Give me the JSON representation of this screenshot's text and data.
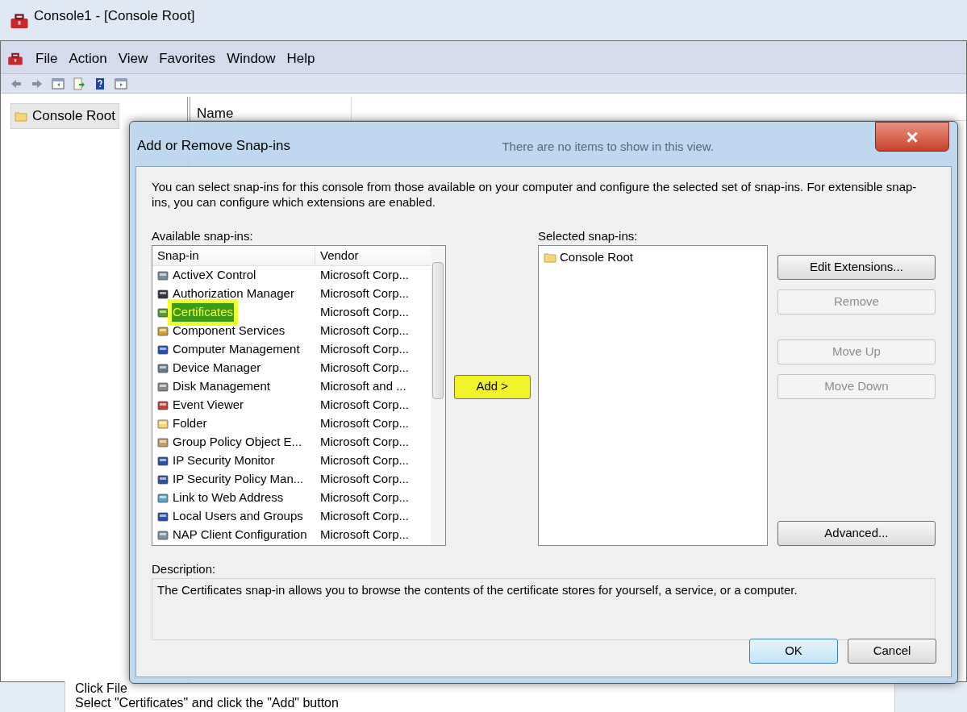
{
  "console": {
    "title": "Console1 - [Console Root]",
    "menu": [
      "File",
      "Action",
      "View",
      "Favorites",
      "Window",
      "Help"
    ],
    "tree": [
      {
        "label": "Console Root",
        "selected": true
      }
    ],
    "columns": [
      "Name"
    ],
    "empty_message": "There are no items to show in this view."
  },
  "dialog": {
    "title": "Add or Remove Snap-ins",
    "close": "×",
    "intro": "You can select snap-ins for this console from those available on your computer and configure the selected set of snap-ins. For extensible snap-ins, you can configure which extensions are enabled.",
    "available_label": "Available snap-ins:",
    "available_columns": [
      "Snap-in",
      "Vendor"
    ],
    "available": [
      {
        "name": "ActiveX Control",
        "vendor": "Microsoft Corp...",
        "selected": false
      },
      {
        "name": "Authorization Manager",
        "vendor": "Microsoft Corp...",
        "selected": false
      },
      {
        "name": "Certificates",
        "vendor": "Microsoft Corp...",
        "selected": true
      },
      {
        "name": "Component Services",
        "vendor": "Microsoft Corp...",
        "selected": false
      },
      {
        "name": "Computer Management",
        "vendor": "Microsoft Corp...",
        "selected": false
      },
      {
        "name": "Device Manager",
        "vendor": "Microsoft Corp...",
        "selected": false
      },
      {
        "name": "Disk Management",
        "vendor": "Microsoft and ...",
        "selected": false
      },
      {
        "name": "Event Viewer",
        "vendor": "Microsoft Corp...",
        "selected": false
      },
      {
        "name": "Folder",
        "vendor": "Microsoft Corp...",
        "selected": false
      },
      {
        "name": "Group Policy Object E...",
        "vendor": "Microsoft Corp...",
        "selected": false
      },
      {
        "name": "IP Security Monitor",
        "vendor": "Microsoft Corp...",
        "selected": false
      },
      {
        "name": "IP Security Policy Man...",
        "vendor": "Microsoft Corp...",
        "selected": false
      },
      {
        "name": "Link to Web Address",
        "vendor": "Microsoft Corp...",
        "selected": false
      },
      {
        "name": "Local Users and Groups",
        "vendor": "Microsoft Corp...",
        "selected": false
      },
      {
        "name": "NAP Client Configuration",
        "vendor": "Microsoft Corp...",
        "selected": false
      }
    ],
    "add_button": {
      "label": "Add >",
      "highlighted": true
    },
    "selected_label": "Selected snap-ins:",
    "selected": [
      {
        "label": "Console Root"
      }
    ],
    "side_buttons": [
      {
        "label": "Edit Extensions...",
        "disabled": false
      },
      {
        "label": "Remove",
        "disabled": true
      },
      {
        "label": "Move Up",
        "disabled": true
      },
      {
        "label": "Move Down",
        "disabled": true
      },
      {
        "label": "Advanced...",
        "disabled": false
      }
    ],
    "description_label": "Description:",
    "description": "The Certificates snap-in allows you to browse the contents of the certificate stores for yourself, a service, or a computer.",
    "buttons": [
      {
        "label": "OK",
        "default": true
      },
      {
        "label": "Cancel",
        "default": false
      }
    ]
  },
  "instructions": [
    "Click File",
    "Select \"Certificates\" and click the \"Add\" button"
  ]
}
